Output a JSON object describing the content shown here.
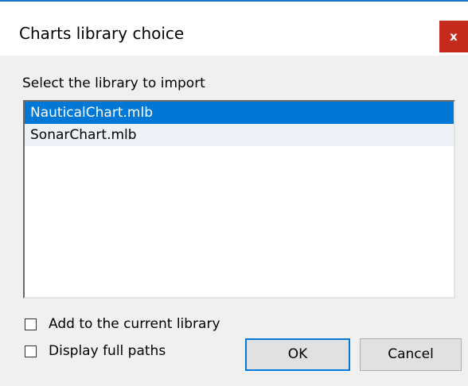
{
  "window": {
    "title": "Charts library choice",
    "close_glyph": "x"
  },
  "prompt": "Select the library to import",
  "libraries": [
    {
      "name": "NauticalChart.mlb",
      "selected": true
    },
    {
      "name": "SonarChart.mlb",
      "selected": false
    }
  ],
  "options": {
    "add_to_current": {
      "label": "Add to the current library",
      "checked": false
    },
    "display_full_paths": {
      "label": "Display full paths",
      "checked": false
    }
  },
  "buttons": {
    "ok": "OK",
    "cancel": "Cancel"
  },
  "colors": {
    "selection": "#0078d7",
    "close_button": "#c42b1c",
    "title_accent": "#1a74d2"
  }
}
